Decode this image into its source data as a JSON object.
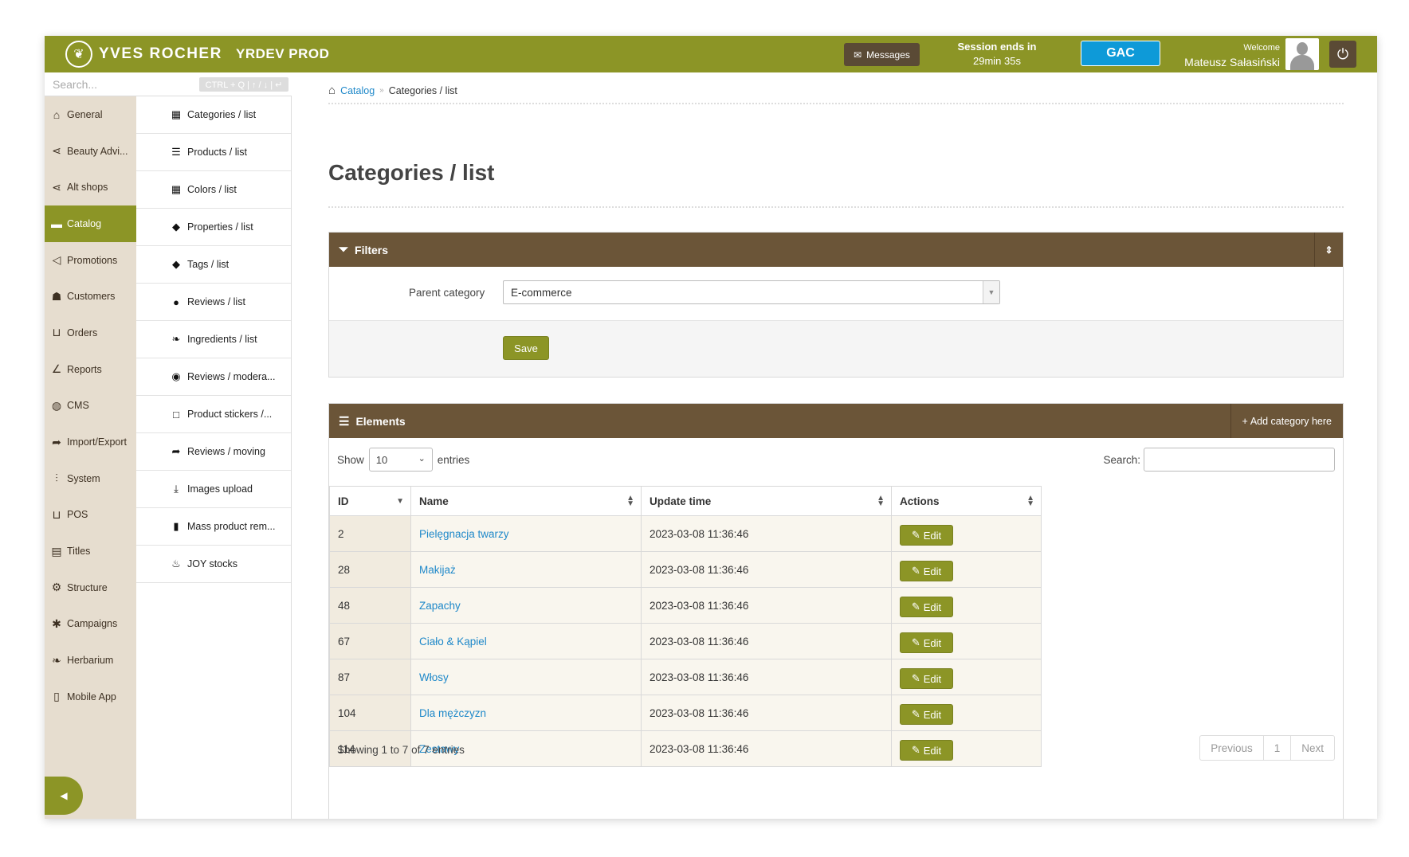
{
  "header": {
    "brand": "YVES ROCHER",
    "environment": "YRDEV PROD",
    "messages_label": "Messages",
    "session_label": "Session ends in",
    "session_time": "29min 35s",
    "gac_label": "GAC",
    "welcome_label": "Welcome",
    "user_name": "Mateusz Sałasiński"
  },
  "search": {
    "placeholder": "Search...",
    "hint": "CTRL + Q | ↑ / ↓ | ↵"
  },
  "sidebar": {
    "items": [
      {
        "label": "General",
        "icon": "home-icon"
      },
      {
        "label": "Beauty Advi...",
        "icon": "share-icon"
      },
      {
        "label": "Alt shops",
        "icon": "share-icon"
      },
      {
        "label": "Catalog",
        "icon": "folder-icon",
        "active": true
      },
      {
        "label": "Promotions",
        "icon": "megaphone-icon"
      },
      {
        "label": "Customers",
        "icon": "users-icon"
      },
      {
        "label": "Orders",
        "icon": "cart-icon"
      },
      {
        "label": "Reports",
        "icon": "line-chart-icon"
      },
      {
        "label": "CMS",
        "icon": "globe-icon"
      },
      {
        "label": "Import/Export",
        "icon": "share-arrow-icon"
      },
      {
        "label": "System",
        "icon": "sliders-icon"
      },
      {
        "label": "POS",
        "icon": "cart-icon"
      },
      {
        "label": "Titles",
        "icon": "id-card-icon"
      },
      {
        "label": "Structure",
        "icon": "gear-icon"
      },
      {
        "label": "Campaigns",
        "icon": "asterisk-icon"
      },
      {
        "label": "Herbarium",
        "icon": "leaf-icon"
      },
      {
        "label": "Mobile App",
        "icon": "mobile-icon"
      }
    ]
  },
  "submenu": {
    "items": [
      {
        "label": "Categories / list",
        "icon": "grid-icon"
      },
      {
        "label": "Products / list",
        "icon": "list-icon"
      },
      {
        "label": "Colors / list",
        "icon": "grid-icon"
      },
      {
        "label": "Properties / list",
        "icon": "tag-icon"
      },
      {
        "label": "Tags / list",
        "icon": "tags-icon"
      },
      {
        "label": "Reviews / list",
        "icon": "comments-icon"
      },
      {
        "label": "Ingredients / list",
        "icon": "leaf-icon"
      },
      {
        "label": "Reviews / modera...",
        "icon": "eye-icon"
      },
      {
        "label": "Product stickers /...",
        "icon": "square-icon"
      },
      {
        "label": "Reviews / moving",
        "icon": "share-arrow-icon"
      },
      {
        "label": "Images upload",
        "icon": "download-icon"
      },
      {
        "label": "Mass product rem...",
        "icon": "trash-icon"
      },
      {
        "label": "JOY stocks",
        "icon": "fire-icon"
      }
    ]
  },
  "breadcrumb": {
    "link": "Catalog",
    "separator": "»",
    "current": "Categories / list"
  },
  "page": {
    "title": "Categories / list"
  },
  "filters": {
    "title": "Filters",
    "parent_category_label": "Parent category",
    "parent_category_value": "E-commerce",
    "save_label": "Save"
  },
  "elements": {
    "title": "Elements",
    "add_label": "Add category here",
    "show_label": "Show",
    "show_value": "10",
    "entries_label": "entries",
    "search_label": "Search:",
    "columns": [
      "ID",
      "Name",
      "Update time",
      "Actions"
    ],
    "rows": [
      {
        "id": "2",
        "name": "Pielęgnacja twarzy",
        "updated": "2023-03-08 11:36:46",
        "action": "Edit"
      },
      {
        "id": "28",
        "name": "Makijaż",
        "updated": "2023-03-08 11:36:46",
        "action": "Edit"
      },
      {
        "id": "48",
        "name": "Zapachy",
        "updated": "2023-03-08 11:36:46",
        "action": "Edit"
      },
      {
        "id": "67",
        "name": "Ciało & Kąpiel",
        "updated": "2023-03-08 11:36:46",
        "action": "Edit"
      },
      {
        "id": "87",
        "name": "Włosy",
        "updated": "2023-03-08 11:36:46",
        "action": "Edit"
      },
      {
        "id": "104",
        "name": "Dla mężczyzn",
        "updated": "2023-03-08 11:36:46",
        "action": "Edit"
      },
      {
        "id": "114",
        "name": "Zestawy",
        "updated": "2023-03-08 11:36:46",
        "action": "Edit"
      }
    ],
    "showing_text": "Showing 1 to 7 of 7 entries",
    "pagination": {
      "previous": "Previous",
      "page": "1",
      "next": "Next"
    }
  },
  "colors": {
    "brand_green": "#8c9526",
    "header_brown": "#6b5538",
    "sidebar_beige": "#e6ddcf",
    "link_blue": "#1e88c9",
    "gac_blue": "#0e9ad8"
  }
}
